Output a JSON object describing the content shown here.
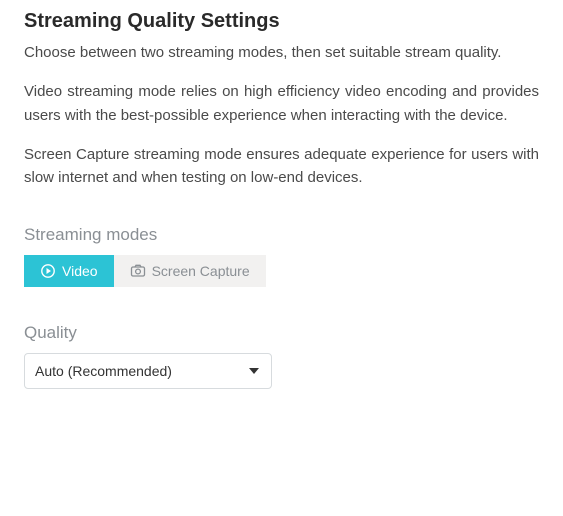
{
  "title": "Streaming Quality Settings",
  "paragraphs": [
    "Choose between two streaming modes, then set suitable stream quality.",
    "Video streaming mode relies on high efficiency video encoding and provides users with the best-possible experience when interacting with the device.",
    "Screen Capture streaming mode ensures adequate experience for users with slow internet and when testing on low-end devices."
  ],
  "modes": {
    "label": "Streaming modes",
    "video": "Video",
    "screen_capture": "Screen Capture"
  },
  "quality": {
    "label": "Quality",
    "selected": "Auto (Recommended)"
  }
}
